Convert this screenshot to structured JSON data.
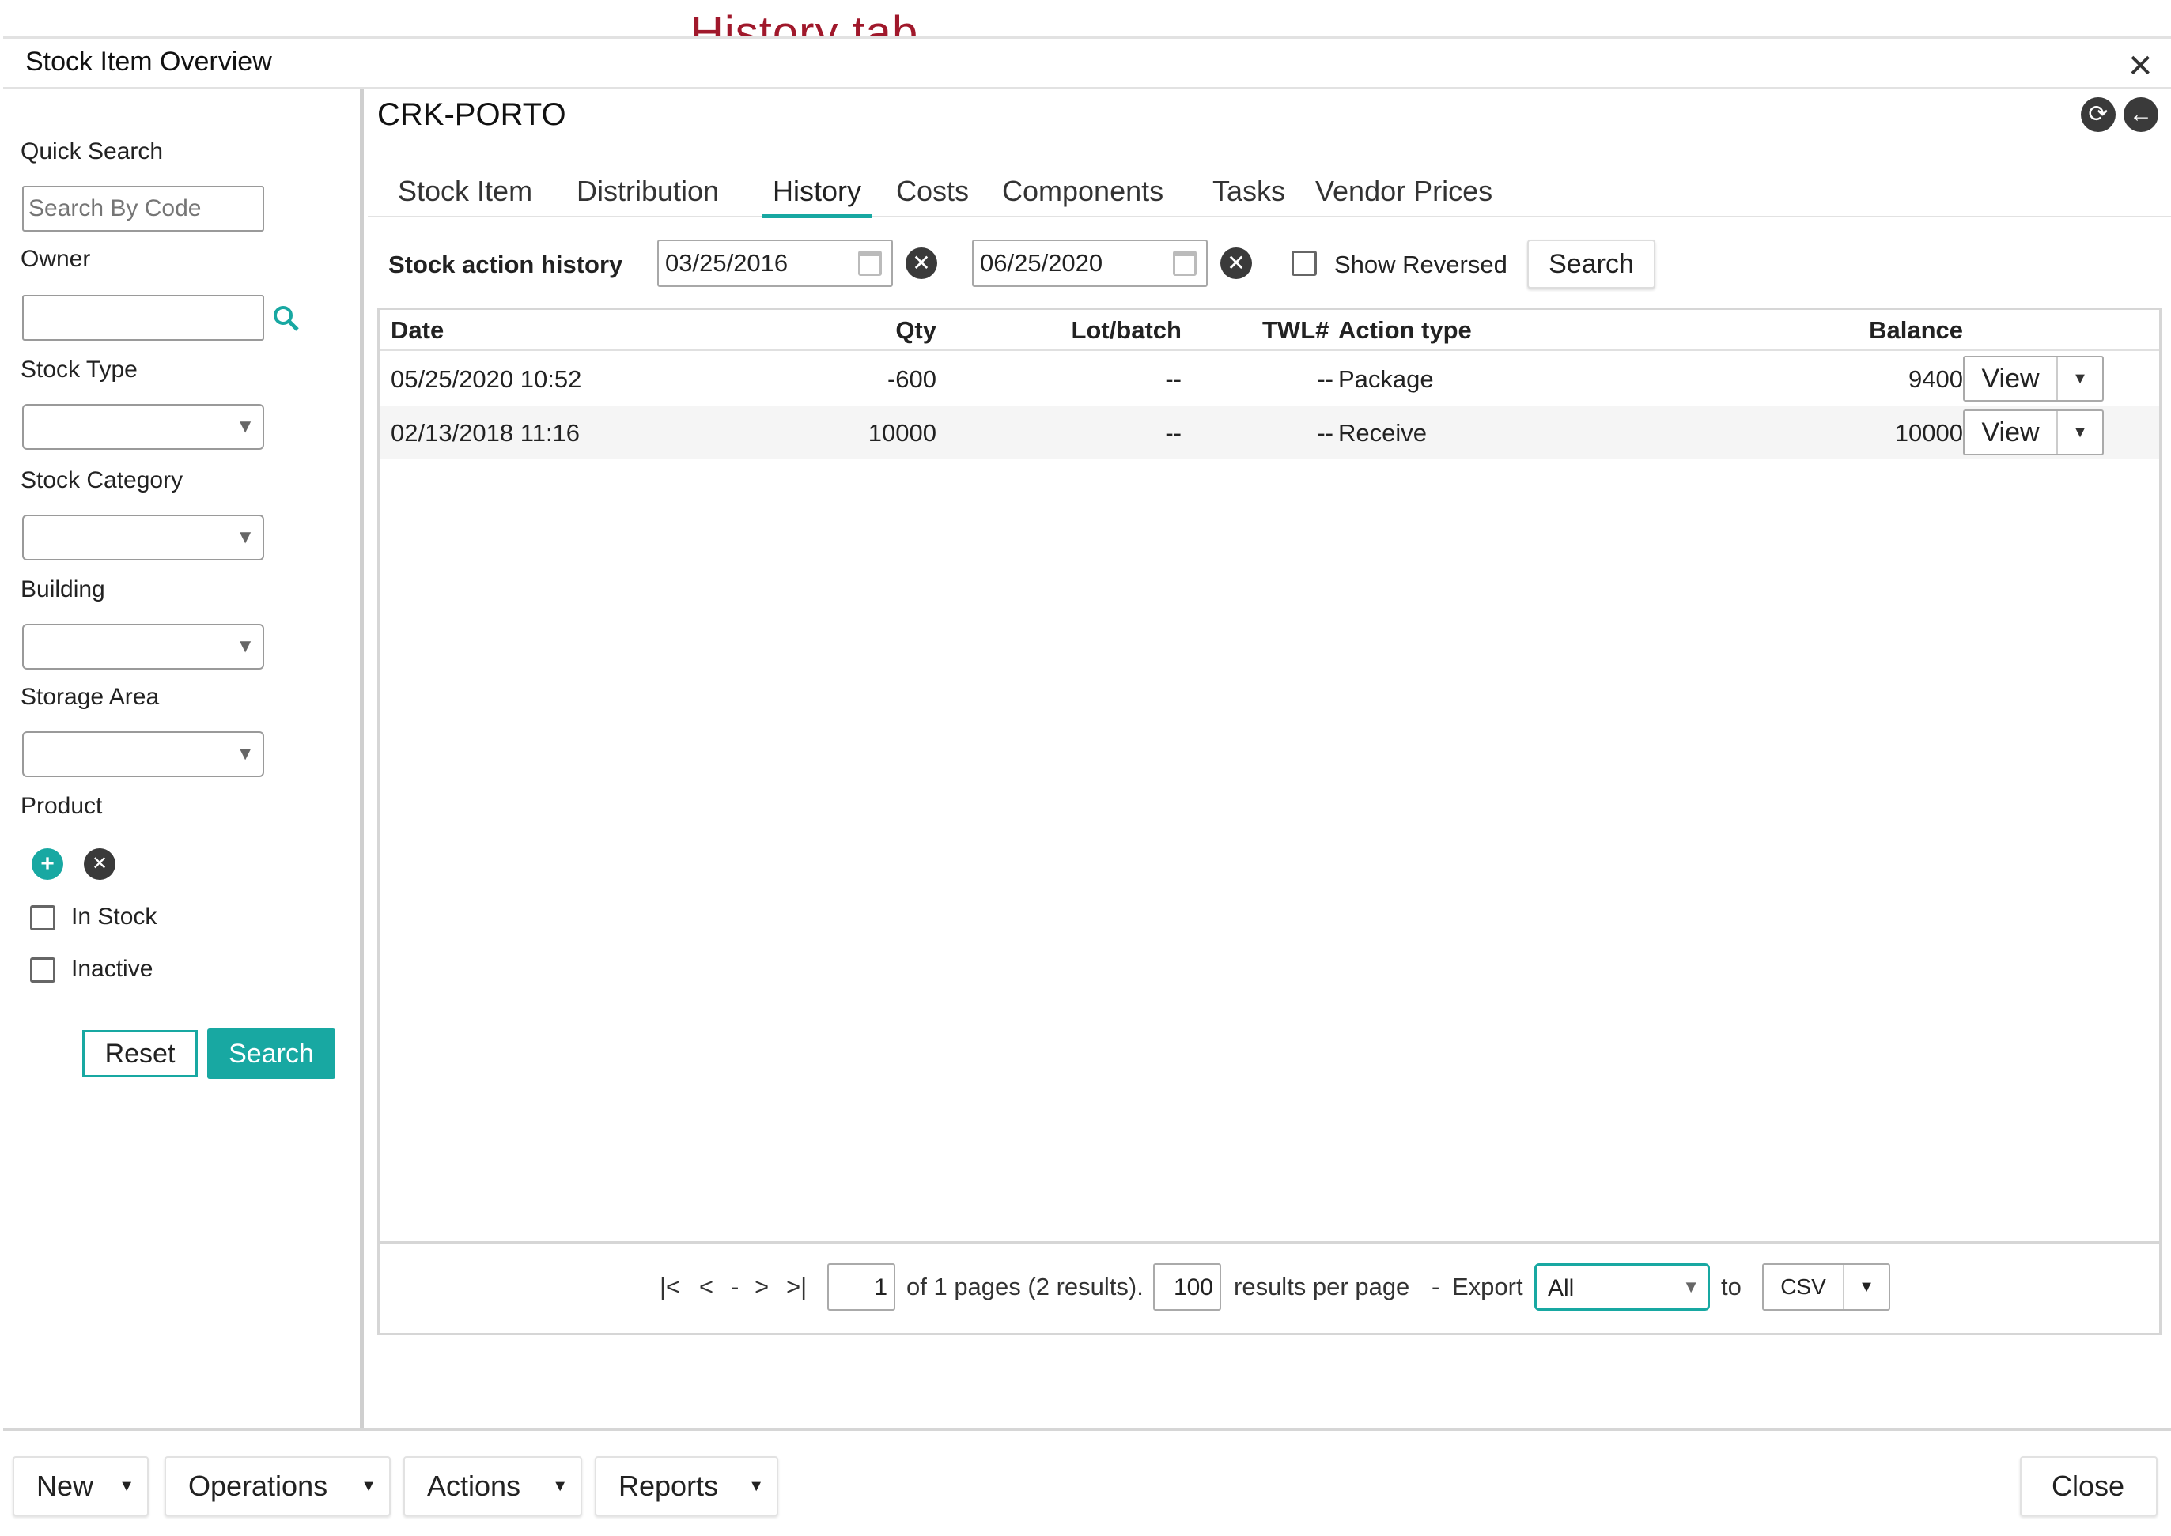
{
  "annotation": {
    "text": "History tab",
    "color": "#a0182b"
  },
  "window": {
    "title": "Stock Item Overview"
  },
  "sidebar": {
    "quick_search_label": "Quick Search",
    "quick_search_placeholder": "Search By Code",
    "owner_label": "Owner",
    "stock_type_label": "Stock Type",
    "stock_category_label": "Stock Category",
    "building_label": "Building",
    "storage_area_label": "Storage Area",
    "product_label": "Product",
    "in_stock_label": "In Stock",
    "inactive_label": "Inactive",
    "reset_label": "Reset",
    "search_label": "Search"
  },
  "main": {
    "item_title": "CRK-PORTO",
    "tabs": [
      {
        "label": "Stock Item"
      },
      {
        "label": "Distribution"
      },
      {
        "label": "History",
        "active": true
      },
      {
        "label": "Costs"
      },
      {
        "label": "Components"
      },
      {
        "label": "Tasks"
      },
      {
        "label": "Vendor Prices"
      }
    ],
    "history_label": "Stock action history",
    "date_from": "03/25/2016",
    "date_to": "06/25/2020",
    "show_reversed_label": "Show Reversed",
    "search_label": "Search",
    "columns": [
      "Date",
      "Qty",
      "Lot/batch",
      "TWL#",
      "Action type",
      "Balance"
    ],
    "rows": [
      {
        "date": "05/25/2020 10:52",
        "qty": "-600",
        "lot": "--",
        "twl": "--",
        "action": "Package",
        "balance": "9400",
        "view": "View"
      },
      {
        "date": "02/13/2018 11:16",
        "qty": "10000",
        "lot": "--",
        "twl": "--",
        "action": "Receive",
        "balance": "10000",
        "view": "View"
      }
    ],
    "pager": {
      "first": "|<",
      "prev": "<",
      "sep": "-",
      "next": ">",
      "last": ">|",
      "page": "1",
      "of_pages": "of 1 pages (2 results).",
      "per_page": "100",
      "per_page_label": "results per page",
      "dash": "-",
      "export_label": "Export",
      "export_value": "All",
      "to_label": "to",
      "format": "CSV"
    }
  },
  "footer": {
    "new_label": "New",
    "operations_label": "Operations",
    "actions_label": "Actions",
    "reports_label": "Reports",
    "close_label": "Close"
  },
  "colors": {
    "accent": "#18a8a2",
    "dark_icon": "#3a3a3a"
  }
}
